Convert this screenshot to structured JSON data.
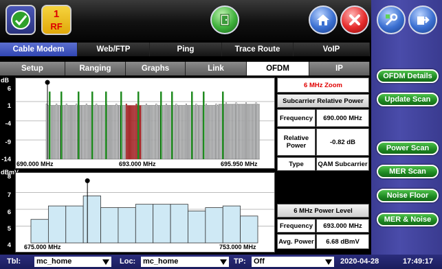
{
  "header": {
    "rf_number": "1",
    "rf_label": "RF"
  },
  "tabs_main": [
    {
      "label": "Cable Modem",
      "active": true
    },
    {
      "label": "Web/FTP"
    },
    {
      "label": "Ping"
    },
    {
      "label": "Trace Route"
    },
    {
      "label": "VoIP"
    }
  ],
  "tabs_sub": [
    {
      "label": "Setup"
    },
    {
      "label": "Ranging"
    },
    {
      "label": "Graphs"
    },
    {
      "label": "Link"
    },
    {
      "label": "OFDM",
      "active": true
    },
    {
      "label": "IP"
    }
  ],
  "top_chart": {
    "unit_label": "dB",
    "y_ticks": [
      "6",
      "1",
      "-4",
      "-9",
      "-14"
    ],
    "x_start": "690.000 MHz",
    "x_mid": "693.000 MHz",
    "x_end": "695.950 MHz"
  },
  "bottom_chart": {
    "unit_label": "dBmV",
    "y_ticks": [
      "8",
      "7",
      "6",
      "5",
      "4"
    ],
    "x_start": "675.000 MHz",
    "x_end": "753.000 MHz"
  },
  "zoom_table": {
    "title": "6 MHz Zoom",
    "header": "Subcarrier Relative Power",
    "rows": [
      {
        "label": "Frequency",
        "value": "690.000 MHz"
      },
      {
        "label": "Relative Power",
        "value": "-0.82 dB"
      },
      {
        "label": "Type",
        "value": "QAM Subcarrier"
      }
    ]
  },
  "power_table": {
    "header": "6 MHz Power Level",
    "rows": [
      {
        "label": "Frequency",
        "value": "693.000 MHz"
      },
      {
        "label": "Avg. Power",
        "value": "6.68 dBmV"
      }
    ]
  },
  "side_buttons": [
    {
      "label": "OFDM Details"
    },
    {
      "label": "Update Scan"
    },
    {
      "label": "Power Scan"
    },
    {
      "label": "MER Scan"
    },
    {
      "label": "Noise Floor"
    },
    {
      "label": "MER & Noise"
    }
  ],
  "status": {
    "tbl_label": "Tbl:",
    "tbl_value": "mc_home",
    "loc_label": "Loc:",
    "loc_value": "mc_home",
    "tp_label": "TP:",
    "tp_value": "Off",
    "date": "2020-04-28",
    "time": "17:49:17"
  },
  "colors": {
    "accent_blue": "#3046b2",
    "button_green": "#1e8a22",
    "zoom_title": "#e00000",
    "bar_fill": "#cfe9f5",
    "pilot_green": "#1f8a1f",
    "highlight_red": "#c0393b"
  },
  "chart_data": [
    {
      "type": "bar",
      "ylabel": "dB",
      "ylim": [
        -14,
        6
      ],
      "x_ticks": [
        "690.000 MHz",
        "693.000 MHz",
        "695.950 MHz"
      ],
      "series": [
        {
          "values_base": 0.0,
          "pilot_level": 3.6,
          "marker_level": 6
        }
      ]
    },
    {
      "type": "bar",
      "ylabel": "dBmV",
      "ylim": [
        4,
        8
      ],
      "x_ticks": [
        "675.000 MHz",
        "753.000 MHz"
      ],
      "values": [
        5.4,
        6.2,
        6.2,
        6.8,
        6.1,
        6.1,
        6.3,
        6.3,
        6.3,
        5.9,
        6.1,
        6.2,
        5.6
      ]
    }
  ]
}
